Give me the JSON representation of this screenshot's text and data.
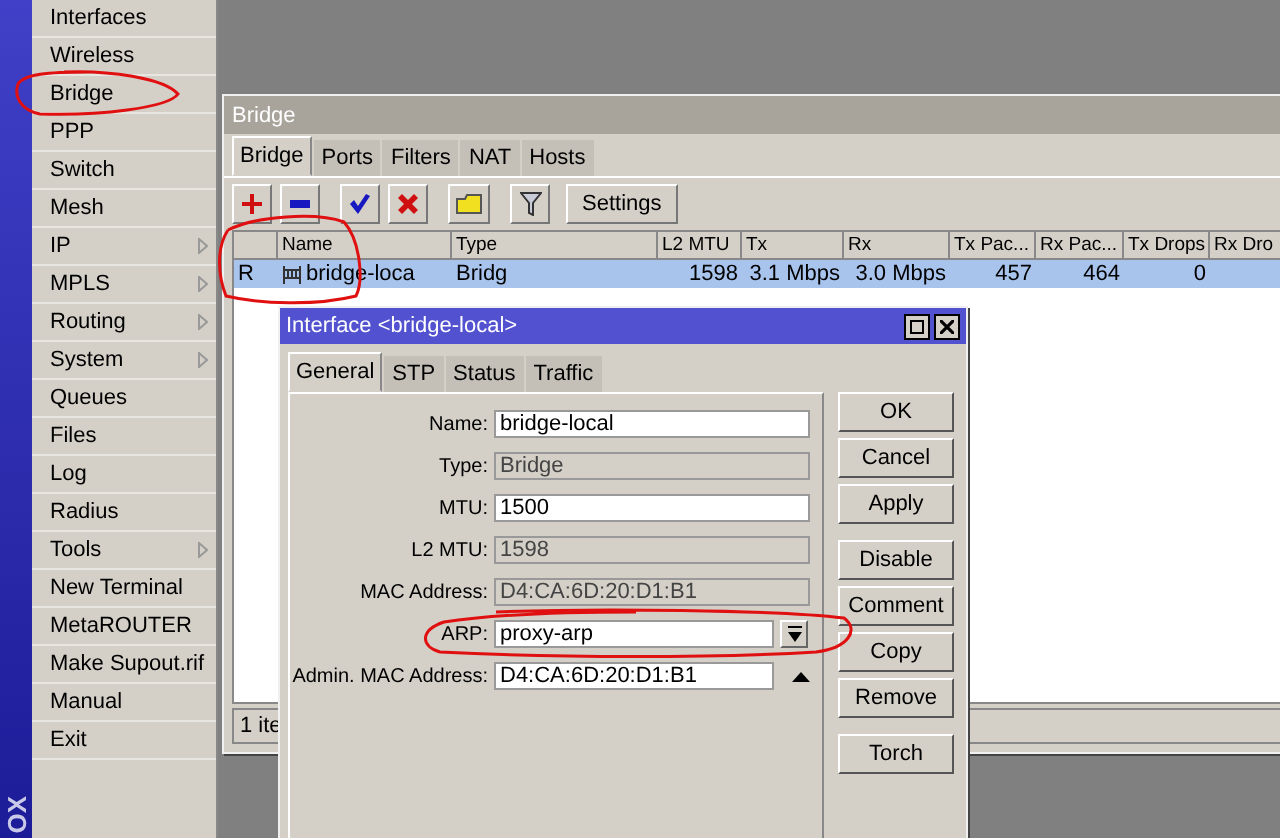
{
  "app_strip": {
    "text": "OX"
  },
  "menu": [
    {
      "label": "Interfaces",
      "submenu": false
    },
    {
      "label": "Wireless",
      "submenu": false
    },
    {
      "label": "Bridge",
      "submenu": false
    },
    {
      "label": "PPP",
      "submenu": false
    },
    {
      "label": "Switch",
      "submenu": false
    },
    {
      "label": "Mesh",
      "submenu": false
    },
    {
      "label": "IP",
      "submenu": true
    },
    {
      "label": "MPLS",
      "submenu": true
    },
    {
      "label": "Routing",
      "submenu": true
    },
    {
      "label": "System",
      "submenu": true
    },
    {
      "label": "Queues",
      "submenu": false
    },
    {
      "label": "Files",
      "submenu": false
    },
    {
      "label": "Log",
      "submenu": false
    },
    {
      "label": "Radius",
      "submenu": false
    },
    {
      "label": "Tools",
      "submenu": true
    },
    {
      "label": "New Terminal",
      "submenu": false
    },
    {
      "label": "MetaROUTER",
      "submenu": false
    },
    {
      "label": "Make Supout.rif",
      "submenu": false
    },
    {
      "label": "Manual",
      "submenu": false
    },
    {
      "label": "Exit",
      "submenu": false
    }
  ],
  "bridge_window": {
    "title": "Bridge",
    "tabs": [
      {
        "label": "Bridge",
        "selected": true
      },
      {
        "label": "Ports",
        "selected": false
      },
      {
        "label": "Filters",
        "selected": false
      },
      {
        "label": "NAT",
        "selected": false
      },
      {
        "label": "Hosts",
        "selected": false
      }
    ],
    "toolbar": [
      {
        "kind": "add"
      },
      {
        "kind": "remove"
      },
      {
        "kind": "enable"
      },
      {
        "kind": "disable"
      },
      {
        "kind": "comment"
      },
      {
        "kind": "filter"
      },
      {
        "kind": "text",
        "label": "Settings"
      }
    ],
    "table": {
      "columns": [
        "Name",
        "Type",
        "L2 MTU",
        "Tx",
        "Rx",
        "Tx Pac...",
        "Rx Pac...",
        "Tx Drops",
        "Rx Dro"
      ],
      "rows": [
        {
          "flag": "R",
          "name": "bridge-loca",
          "type": "Bridg",
          "l2_mtu": "1598",
          "tx": "3.1 Mbps",
          "rx": "3.0 Mbps",
          "tx_packets": "457",
          "rx_packets": "464",
          "tx_drops": "0",
          "selected": true
        }
      ]
    },
    "status": "1 ite"
  },
  "dialog": {
    "title": "Interface <bridge-local>",
    "tabs": [
      {
        "label": "General",
        "selected": true
      },
      {
        "label": "STP",
        "selected": false
      },
      {
        "label": "Status",
        "selected": false
      },
      {
        "label": "Traffic",
        "selected": false
      }
    ],
    "fields": [
      {
        "label": "Name:",
        "value": "bridge-local",
        "kind": "text"
      },
      {
        "label": "Type:",
        "value": "Bridge",
        "kind": "readonly"
      },
      {
        "label": "MTU:",
        "value": "1500",
        "kind": "text"
      },
      {
        "label": "L2 MTU:",
        "value": "1598",
        "kind": "readonly"
      },
      {
        "label": "MAC Address:",
        "value": "D4:CA:6D:20:D1:B1",
        "kind": "readonly"
      },
      {
        "label": "ARP:",
        "value": "proxy-arp",
        "kind": "dropdown"
      },
      {
        "label": "Admin. MAC Address:",
        "value": "D4:CA:6D:20:D1:B1",
        "kind": "collapsible"
      }
    ],
    "button_groups": [
      [
        "OK",
        "Cancel",
        "Apply"
      ],
      [
        "Disable",
        "Comment",
        "Copy",
        "Remove"
      ],
      [
        "Torch"
      ]
    ]
  }
}
